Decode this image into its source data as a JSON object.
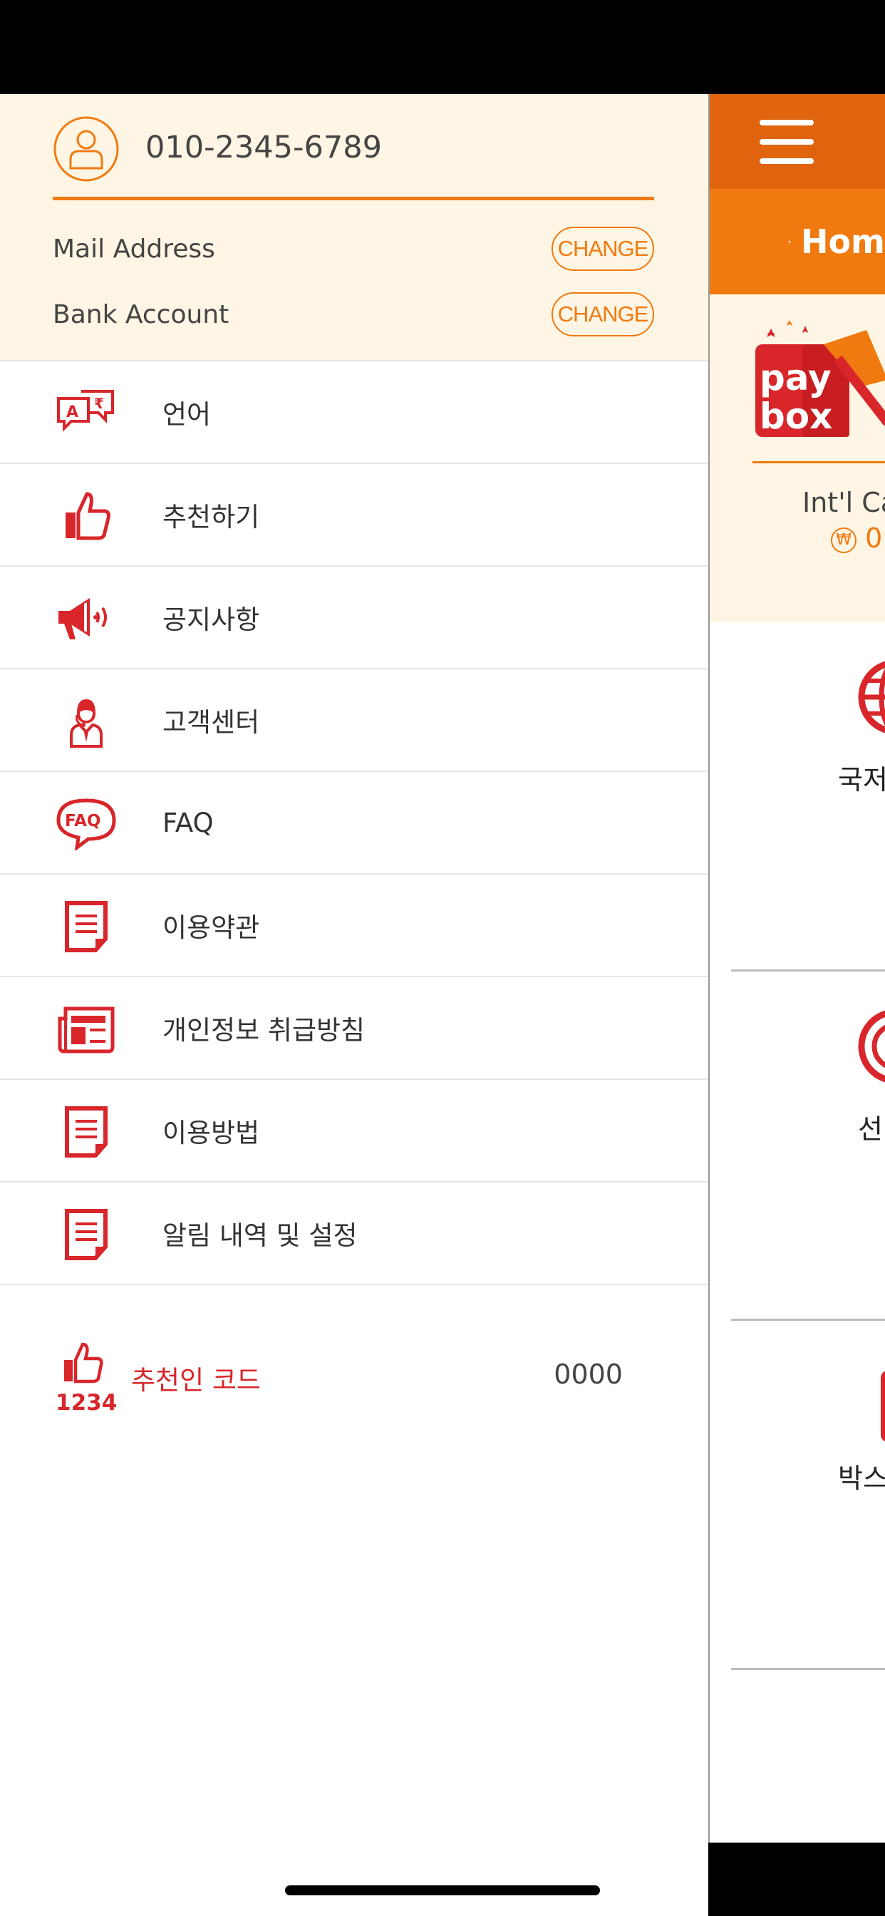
{
  "drawer": {
    "phone": "010-2345-6789",
    "mail_label": "Mail Address",
    "bank_label": "Bank Account",
    "change_label": "CHANGE",
    "menu": [
      {
        "label": "언어",
        "icon": "language-icon"
      },
      {
        "label": "추천하기",
        "icon": "thumbs-up-icon"
      },
      {
        "label": "공지사항",
        "icon": "megaphone-icon"
      },
      {
        "label": "고객센터",
        "icon": "support-agent-icon"
      },
      {
        "label": "FAQ",
        "icon": "faq-icon"
      },
      {
        "label": "이용약관",
        "icon": "document-icon"
      },
      {
        "label": "개인정보 취급방침",
        "icon": "newspaper-icon"
      },
      {
        "label": "이용방법",
        "icon": "document-icon"
      },
      {
        "label": "알림 내역 및 설정",
        "icon": "document-icon"
      }
    ],
    "referral": {
      "label": "추천인 코드",
      "code": "0000",
      "icon_text": "1234"
    }
  },
  "page": {
    "nav_label": "Hom",
    "logo_text_1": "pay",
    "logo_text_2": "box",
    "card_label": "Int'l Ca",
    "card_amount": "0",
    "tiles": [
      "국저",
      "선",
      "박스"
    ]
  },
  "colors": {
    "orange": "#f07a10",
    "dark_orange": "#e0640e",
    "red": "#d8262a",
    "cream": "#fff5e4"
  }
}
